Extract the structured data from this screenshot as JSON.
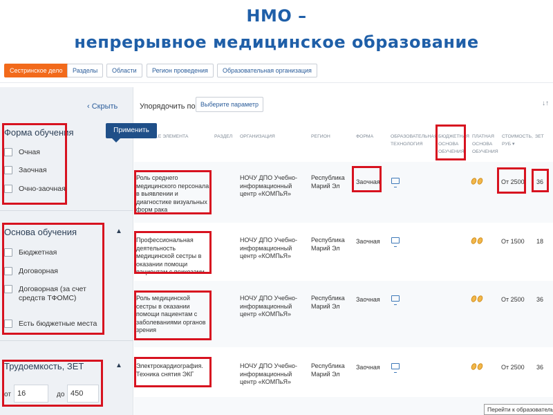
{
  "slide": {
    "title_line1": "НМО –",
    "title_line2": "непрерывное медицинское образование"
  },
  "topbar": {
    "chips": [
      "Сестринское дело",
      "Разделы",
      "Области",
      "Регион проведения",
      "Образовательная организация"
    ]
  },
  "sidebar": {
    "hide_label": "‹ Скрыть",
    "apply_label": "Применить",
    "forma": {
      "title": "Форма обучения",
      "options": [
        "Очная",
        "Заочная",
        "Очно-заочная"
      ]
    },
    "osnova": {
      "title": "Основа обучения",
      "options": [
        "Бюджетная",
        "Договорная",
        "Договорная (за счет средств ТФОМС)",
        "Есть бюджетные места"
      ]
    },
    "trud": {
      "title": "Трудоемкость, ЗЕТ",
      "from_label": "от",
      "from_value": "16",
      "to_label": "до",
      "to_value": "450"
    }
  },
  "main": {
    "sort_label": "Упорядочить по:",
    "sort_button": "Выберите параметр",
    "columns": [
      "…Е ЭЛЕМЕНТА",
      "РАЗДЕЛ",
      "ОРГАНИЗАЦИЯ",
      "РЕГИОН",
      "ФОРМА",
      "ОБРАЗОВАТЕЛЬНАЯ ТЕХНОЛОГИЯ",
      "БЮДЖЕТНАЯ ОСНОВА ОБУЧЕНИЯ",
      "ПЛАТНАЯ ОСНОВА ОБУЧЕНИЯ",
      "СТОИМОСТЬ, РУБ ▾",
      "ЗЕТ"
    ],
    "rows": [
      {
        "name": "Роль среднего медицинского персонала в выявлении и диагностике визуальных форм рака",
        "org": "НОЧУ ДПО Учебно-информационный центр «КОМПьЯ»",
        "region": "Республика Марий Эл",
        "form": "Заочная",
        "cost": "От 2500",
        "zet": "36"
      },
      {
        "name": "Профессиональная деятельность медицинской сестры в оказании помощи пациентам с психозами",
        "org": "НОЧУ ДПО Учебно-информационный центр «КОМПьЯ»",
        "region": "Республика Марий Эл",
        "form": "Заочная",
        "cost": "От 1500",
        "zet": "18"
      },
      {
        "name": "Роль медицинской сестры в оказании помощи пациентам с заболеваниями органов зрения",
        "org": "НОЧУ ДПО Учебно-информационный центр «КОМПьЯ»",
        "region": "Республика Марий Эл",
        "form": "Заочная",
        "cost": "От 2500",
        "zet": "36"
      },
      {
        "name": "Электрокардиография. Техника снятия ЭКГ",
        "org": "НОЧУ ДПО Учебно-информационный центр «КОМПьЯ»",
        "region": "Республика Марий Эл",
        "form": "Заочная",
        "cost": "От 2500",
        "zet": "36"
      }
    ],
    "tooltip": "Перейти к образовательной"
  },
  "colors": {
    "title": "#1f5fa8",
    "highlight": "#d7121f",
    "active_chip": "#f26a1b",
    "apply_button": "#1f4f88"
  }
}
